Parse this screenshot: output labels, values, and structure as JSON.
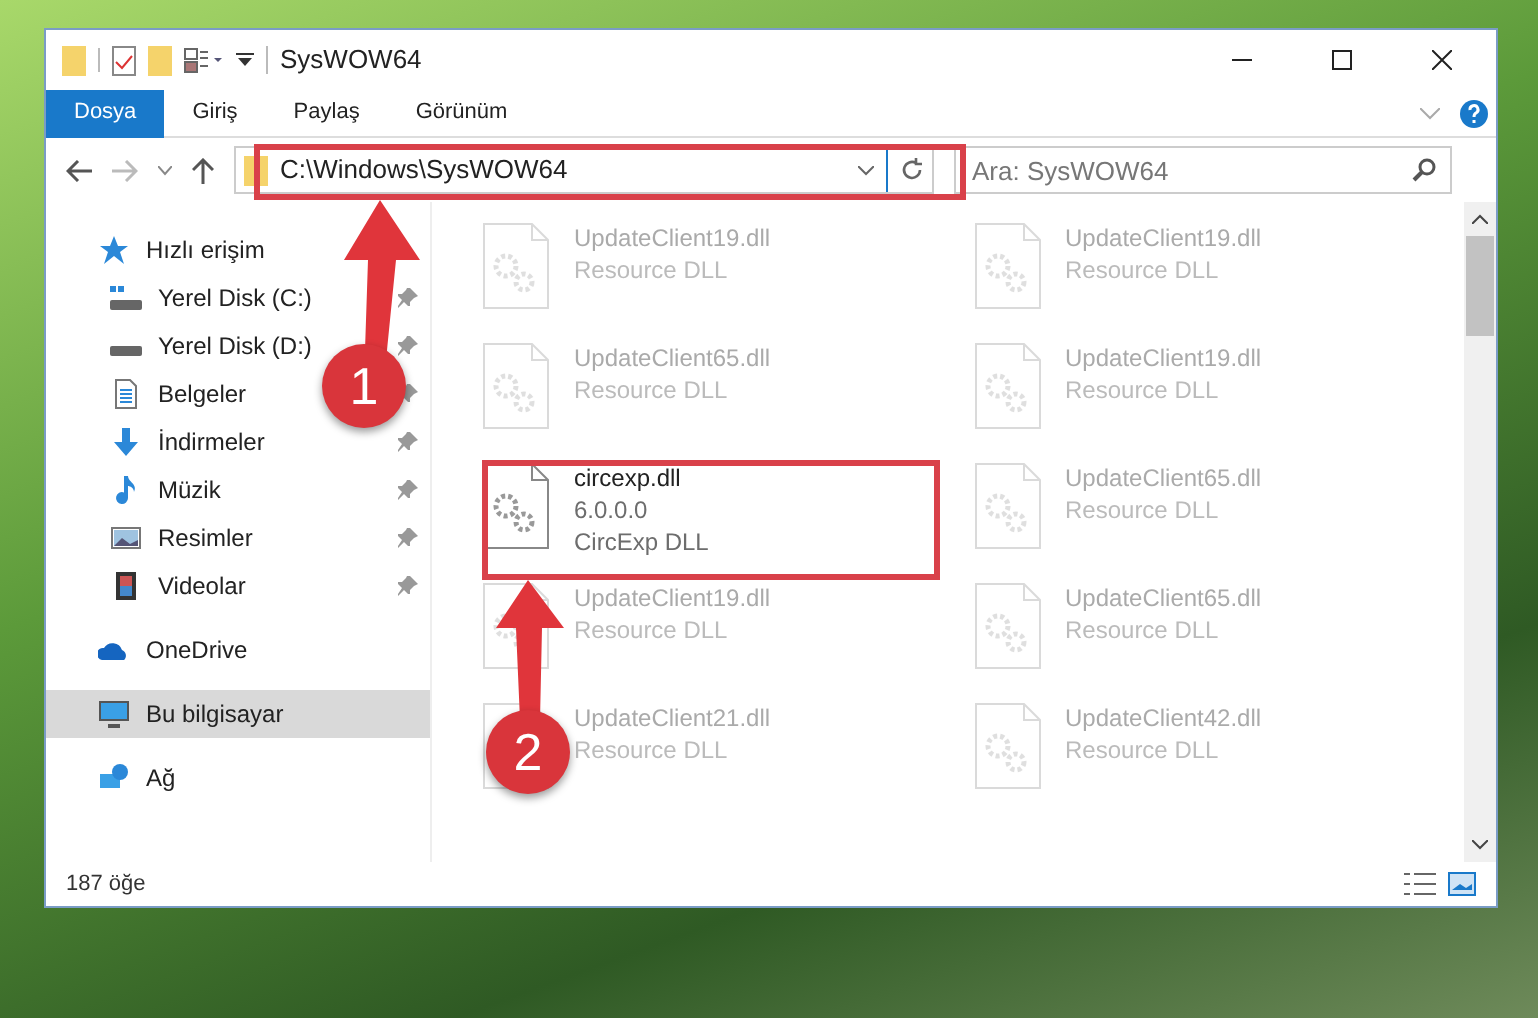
{
  "window": {
    "title": "SysWOW64"
  },
  "ribbon": {
    "tabs": [
      {
        "label": "Dosya",
        "selected": true
      },
      {
        "label": "Giriş",
        "selected": false
      },
      {
        "label": "Paylaş",
        "selected": false
      },
      {
        "label": "Görünüm",
        "selected": false
      }
    ]
  },
  "address": {
    "path": "C:\\Windows\\SysWOW64"
  },
  "search": {
    "placeholder": "Ara: SysWOW64"
  },
  "sidebar": {
    "items": [
      {
        "label": "Hızlı erişim",
        "kind": "star",
        "selected": false,
        "children": [
          {
            "label": "Yerel Disk (C:)",
            "kind": "system-drive",
            "pinned": true,
            "selected": false
          },
          {
            "label": "Yerel Disk (D:)",
            "kind": "drive",
            "pinned": true,
            "selected": false
          },
          {
            "label": "Belgeler",
            "kind": "documents",
            "pinned": true,
            "selected": false
          },
          {
            "label": "İndirmeler",
            "kind": "downloads",
            "pinned": true,
            "selected": false
          },
          {
            "label": "Müzik",
            "kind": "music",
            "pinned": true,
            "selected": false
          },
          {
            "label": "Resimler",
            "kind": "pictures",
            "pinned": true,
            "selected": false
          },
          {
            "label": "Videolar",
            "kind": "videos",
            "pinned": true,
            "selected": false
          }
        ]
      },
      {
        "label": "OneDrive",
        "kind": "cloud",
        "selected": false
      },
      {
        "label": "Bu bilgisayar",
        "kind": "computer",
        "selected": true
      },
      {
        "label": "Ağ",
        "kind": "network",
        "selected": false
      }
    ]
  },
  "files": [
    {
      "name": "UpdateClient19.dll",
      "details": [
        "Resource DLL"
      ],
      "dimmed": true
    },
    {
      "name": "UpdateClient19.dll",
      "details": [
        "Resource DLL"
      ],
      "dimmed": true
    },
    {
      "name": "UpdateClient65.dll",
      "details": [
        "Resource DLL"
      ],
      "dimmed": true
    },
    {
      "name": "UpdateClient19.dll",
      "details": [
        "Resource DLL"
      ],
      "dimmed": true
    },
    {
      "name": "circexp.dll",
      "details": [
        "6.0.0.0",
        "CircExp DLL"
      ],
      "dimmed": false
    },
    {
      "name": "UpdateClient65.dll",
      "details": [
        "Resource DLL"
      ],
      "dimmed": true
    },
    {
      "name": "UpdateClient19.dll",
      "details": [
        "Resource DLL"
      ],
      "dimmed": true
    },
    {
      "name": "UpdateClient65.dll",
      "details": [
        "Resource DLL"
      ],
      "dimmed": true
    },
    {
      "name": "UpdateClient21.dll",
      "details": [
        "Resource DLL"
      ],
      "dimmed": true
    },
    {
      "name": "UpdateClient42.dll",
      "details": [
        "Resource DLL"
      ],
      "dimmed": true
    }
  ],
  "status_bar": {
    "count": "187 öğe"
  },
  "annotations": [
    {
      "label": "1"
    },
    {
      "label": "2"
    }
  ]
}
